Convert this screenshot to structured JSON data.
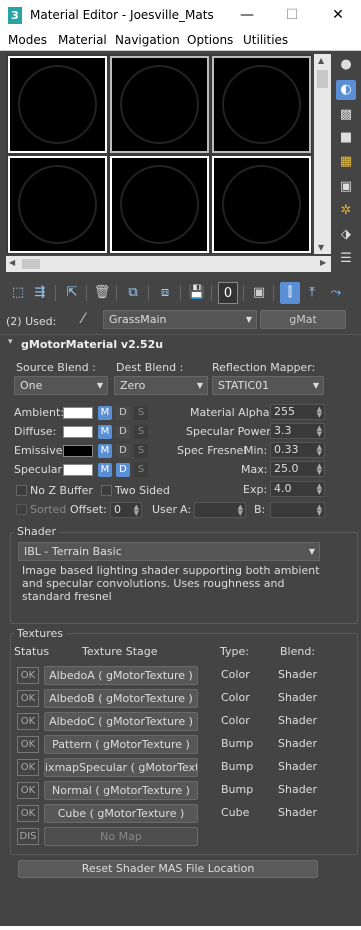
{
  "window": {
    "title": "Material Editor - Joesville_Mats",
    "icon": "3",
    "minimize": "—",
    "maximize": "☐",
    "close": "✕"
  },
  "menu": [
    "Modes",
    "Material",
    "Navigation",
    "Options",
    "Utilities"
  ],
  "used": {
    "label": "(2) Used:",
    "material_name": "GrassMain",
    "material_type": "gMat"
  },
  "rollout": {
    "title": "gMotorMaterial v2.52u",
    "collapse_icon": "▾"
  },
  "blend": {
    "source_label": "Source Blend :",
    "source_value": "One",
    "dest_label": "Dest Blend :",
    "dest_value": "Zero",
    "reflection_label": "Reflection Mapper:",
    "reflection_value": "STATIC01"
  },
  "colors": {
    "rows": [
      {
        "label": "Ambient:",
        "swatch": "#ffffff",
        "m": "M",
        "d": "D",
        "s": "S"
      },
      {
        "label": "Diffuse:",
        "swatch": "#ffffff",
        "m": "M",
        "d": "D",
        "s": "S"
      },
      {
        "label": "Emissive:",
        "swatch": "#000000",
        "m": "M",
        "d": "D",
        "s": "S"
      },
      {
        "label": "Specular:",
        "swatch": "#ffffff",
        "m": "M",
        "d": "D",
        "s": "S"
      }
    ]
  },
  "params": {
    "alpha_label": "Material Alpha :",
    "alpha_value": "255",
    "power_label": "Specular Power:",
    "power_value": "3.3",
    "fresnel_label": "Spec Fresnel",
    "min_label": "Min:",
    "min_value": "0.33",
    "max_label": "Max:",
    "max_value": "25.0",
    "exp_label": "Exp:",
    "exp_value": "4.0"
  },
  "flags": {
    "no_z_buffer": "No Z Buffer",
    "two_sided": "Two Sided",
    "sorted": "Sorted",
    "offset_label": "Offset:",
    "offset_value": "0",
    "user_label": "User",
    "a_label": "A:",
    "b_label": "B:"
  },
  "shader": {
    "group_label": "Shader",
    "selected": "IBL - Terrain Basic",
    "description": "Image based lighting shader supporting both ambient and specular convolutions. Uses roughness and standard fresnel"
  },
  "textures": {
    "group_label": "Textures",
    "col_status": "Status",
    "col_stage": "Texture Stage",
    "col_type": "Type:",
    "col_blend": "Blend:",
    "rows": [
      {
        "status": "OK",
        "stage": "AlbedoA ( gMotorTexture )",
        "type": "Color",
        "blend": "Shader"
      },
      {
        "status": "OK",
        "stage": "AlbedoB ( gMotorTexture )",
        "type": "Color",
        "blend": "Shader"
      },
      {
        "status": "OK",
        "stage": "AlbedoC ( gMotorTexture )",
        "type": "Color",
        "blend": "Shader"
      },
      {
        "status": "OK",
        "stage": "Pattern ( gMotorTexture )",
        "type": "Bump",
        "blend": "Shader"
      },
      {
        "status": "OK",
        "stage": "ixmapSpecular ( gMotorTexture",
        "type": "Bump",
        "blend": "Shader"
      },
      {
        "status": "OK",
        "stage": "Normal ( gMotorTexture )",
        "type": "Bump",
        "blend": "Shader"
      },
      {
        "status": "OK",
        "stage": "Cube ( gMotorTexture )",
        "type": "Cube",
        "blend": "Shader"
      },
      {
        "status": "DIS",
        "stage": "No Map",
        "type": "",
        "blend": ""
      }
    ]
  },
  "reset_button": "Reset Shader MAS File Location"
}
